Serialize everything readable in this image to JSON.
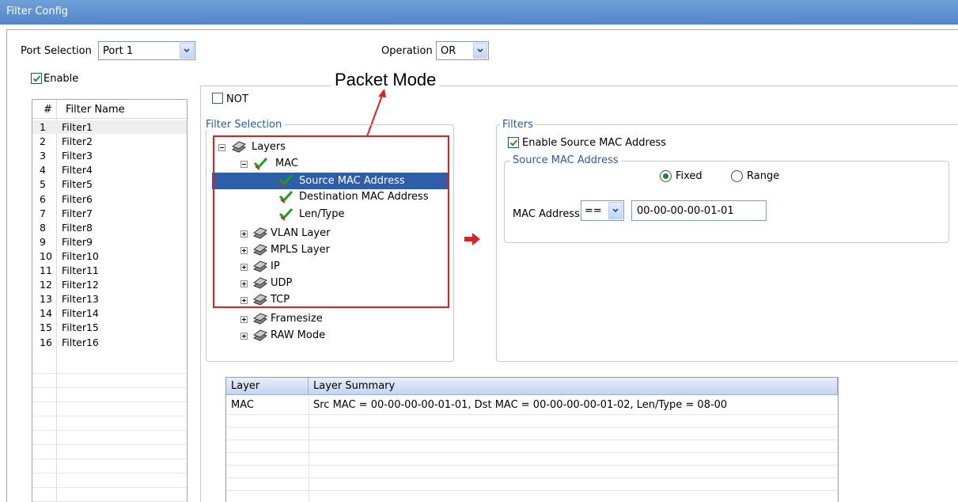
{
  "window": {
    "title": "Filter Config"
  },
  "port_selection": {
    "label": "Port Selection",
    "value": "Port 1"
  },
  "operation": {
    "label": "Operation",
    "value": "OR"
  },
  "enable": {
    "label": "Enable",
    "checked": true
  },
  "filter_list": {
    "headers": [
      "#",
      "Filter Name"
    ],
    "rows": [
      {
        "n": "1",
        "name": "Filter1"
      },
      {
        "n": "2",
        "name": "Filter2"
      },
      {
        "n": "3",
        "name": "Filter3"
      },
      {
        "n": "4",
        "name": "Filter4"
      },
      {
        "n": "5",
        "name": "Filter5"
      },
      {
        "n": "6",
        "name": "Filter6"
      },
      {
        "n": "7",
        "name": "Filter7"
      },
      {
        "n": "8",
        "name": "Filter8"
      },
      {
        "n": "9",
        "name": "Filter9"
      },
      {
        "n": "10",
        "name": "Filter10"
      },
      {
        "n": "11",
        "name": "Filter11"
      },
      {
        "n": "12",
        "name": "Filter12"
      },
      {
        "n": "13",
        "name": "Filter13"
      },
      {
        "n": "14",
        "name": "Filter14"
      },
      {
        "n": "15",
        "name": "Filter15"
      },
      {
        "n": "16",
        "name": "Filter16"
      }
    ],
    "selected_index": 0
  },
  "annotation": {
    "text": "Packet Mode",
    "color": "#e02020"
  },
  "not_checkbox": {
    "label": "NOT",
    "checked": false
  },
  "filter_selection": {
    "title": "Filter Selection",
    "tree": {
      "root": "Layers",
      "mac": "MAC",
      "source_mac": "Source MAC Address",
      "dest_mac": "Destination MAC Address",
      "len_type": "Len/Type",
      "vlan": "VLAN Layer",
      "mpls": "MPLS Layer",
      "ip": "IP",
      "udp": "UDP",
      "tcp": "TCP",
      "framesize": "Framesize",
      "raw": "RAW Mode"
    }
  },
  "filters": {
    "title": "Filters",
    "enable_source_mac": {
      "label": "Enable Source MAC Address",
      "checked": true
    },
    "source_mac_group": {
      "title": "Source MAC Address",
      "fixed_label": "Fixed",
      "range_label": "Range",
      "selected": "Fixed",
      "mac_label": "MAC Address",
      "operator": "==",
      "mac_value": "00-00-00-00-01-01"
    }
  },
  "summary_table": {
    "headers": [
      "Layer",
      "Layer Summary"
    ],
    "rows": [
      {
        "layer": "MAC",
        "summary": "Src MAC = 00-00-00-00-01-01, Dst MAC = 00-00-00-00-01-02, Len/Type  = 08-00"
      }
    ]
  },
  "colors": {
    "selection": "#2f5ea8",
    "titlebar": "#5f8fd0",
    "annotation": "#e02020",
    "group_label": "#2a5aa8"
  }
}
